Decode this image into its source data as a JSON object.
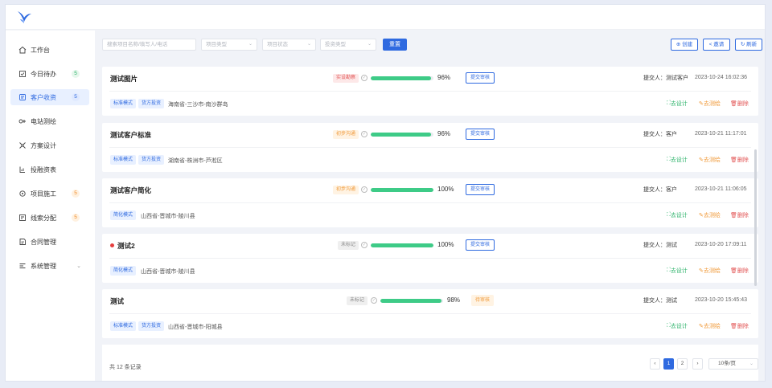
{
  "sidebar": {
    "items": [
      {
        "label": "工作台",
        "icon": "home-icon",
        "badge": ""
      },
      {
        "label": "今日待办",
        "icon": "todo-icon",
        "badge": "5",
        "badge_color": "green"
      },
      {
        "label": "客户收资",
        "icon": "customer-data-icon",
        "badge": "5",
        "badge_color": "blue",
        "active": true
      },
      {
        "label": "电站测绘",
        "icon": "survey-icon",
        "badge": ""
      },
      {
        "label": "方案设计",
        "icon": "design-icon",
        "badge": ""
      },
      {
        "label": "投融资表",
        "icon": "finance-icon",
        "badge": ""
      },
      {
        "label": "项目施工",
        "icon": "construction-icon",
        "badge": "5",
        "badge_color": "orange"
      },
      {
        "label": "线索分配",
        "icon": "lead-icon",
        "badge": "5",
        "badge_color": "orange"
      },
      {
        "label": "合同管理",
        "icon": "contract-icon",
        "badge": ""
      },
      {
        "label": "系统管理",
        "icon": "system-icon",
        "badge": "",
        "expandable": true
      }
    ]
  },
  "filters": {
    "search_placeholder": "搜索项目名称/填写人/电话",
    "type_placeholder": "项目类型",
    "status_placeholder": "项目状态",
    "invest_placeholder": "投资类型",
    "reset_label": "重置"
  },
  "toolbar": {
    "create_label": "创建",
    "invite_label": "邀请",
    "refresh_label": "刷新"
  },
  "records": [
    {
      "title": "测试图片",
      "status": "实设勘察",
      "status_color": "red",
      "progress": 96,
      "progress_text": "96%",
      "review": "提交审核",
      "review_pending": false,
      "submitter_label": "提交人：",
      "submitter": "测试客户",
      "time": "2023-10-24 16:02:36",
      "tags": [
        "标准模式",
        "货方投资"
      ],
      "region": "海南省-三沙市-南沙群岛",
      "dot": false
    },
    {
      "title": "测试客户标准",
      "status": "初步沟通",
      "status_color": "orange",
      "progress": 96,
      "progress_text": "96%",
      "review": "提交审核",
      "review_pending": false,
      "submitter_label": "提交人：",
      "submitter": "客户",
      "time": "2023-10-21 11:17:01",
      "tags": [
        "标准模式",
        "货方投资"
      ],
      "region": "湖南省-株洲市-芦淞区",
      "dot": false
    },
    {
      "title": "测试客户简化",
      "status": "初步沟通",
      "status_color": "orange",
      "progress": 100,
      "progress_text": "100%",
      "review": "提交审核",
      "review_pending": false,
      "submitter_label": "提交人：",
      "submitter": "客户",
      "time": "2023-10-21 11:06:05",
      "tags": [
        "简化模式"
      ],
      "region": "山西省-晋城市-陵川县",
      "dot": false
    },
    {
      "title": "测试2",
      "status": "未标记",
      "status_color": "gray",
      "progress": 100,
      "progress_text": "100%",
      "review": "提交审核",
      "review_pending": false,
      "submitter_label": "提交人：",
      "submitter": "测试",
      "time": "2023-10-20 17:09:11",
      "tags": [
        "简化模式"
      ],
      "region": "山西省-晋城市-陵川县",
      "dot": true
    },
    {
      "title": "测试",
      "status": "未标记",
      "status_color": "gray",
      "progress": 98,
      "progress_text": "98%",
      "review": "待审核",
      "review_pending": true,
      "submitter_label": "提交人：",
      "submitter": "测试",
      "time": "2023-10-20 15:45:43",
      "tags": [
        "标准模式",
        "货方投资"
      ],
      "region": "山西省-晋城市-阳城县",
      "dot": false
    }
  ],
  "actions": {
    "design": "去设计",
    "survey": "去测绘",
    "delete": "删除"
  },
  "pagination": {
    "total_text": "共 12 条记录",
    "prev": "‹",
    "page1": "1",
    "page2": "2",
    "next": "›",
    "page_size": "10条/页"
  },
  "colors": {
    "accent": "#2f6ae0",
    "progress": "#3ecb87",
    "danger": "#e25555",
    "warning": "#f09a3a",
    "success": "#2db36b"
  }
}
